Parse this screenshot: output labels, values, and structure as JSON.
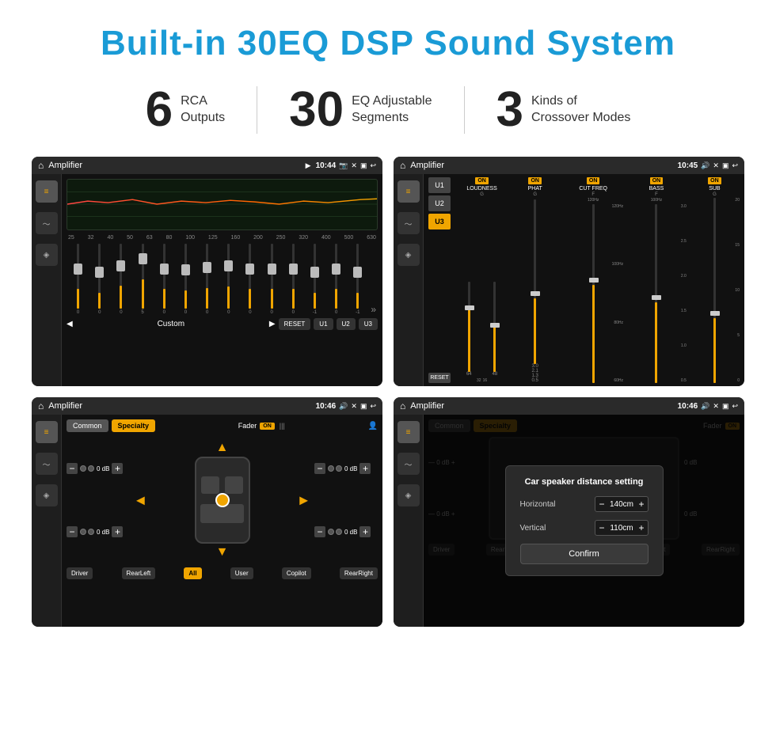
{
  "header": {
    "title": "Built-in 30EQ DSP Sound System"
  },
  "stats": [
    {
      "number": "6",
      "text_line1": "RCA",
      "text_line2": "Outputs"
    },
    {
      "number": "30",
      "text_line1": "EQ Adjustable",
      "text_line2": "Segments"
    },
    {
      "number": "3",
      "text_line1": "Kinds of",
      "text_line2": "Crossover Modes"
    }
  ],
  "screens": {
    "eq": {
      "title": "Amplifier",
      "time": "10:44",
      "freq_labels": [
        "25",
        "32",
        "40",
        "50",
        "63",
        "80",
        "100",
        "125",
        "160",
        "200",
        "250",
        "320",
        "400",
        "500",
        "630"
      ],
      "bottom_label": "Custom",
      "reset_btn": "RESET",
      "preset_btns": [
        "U1",
        "U2",
        "U3"
      ],
      "values": [
        "0",
        "0",
        "0",
        "5",
        "0",
        "0",
        "0",
        "0",
        "0",
        "0",
        "0",
        "-1",
        "0",
        "-1"
      ]
    },
    "dsp": {
      "title": "Amplifier",
      "time": "10:45",
      "presets": [
        "U1",
        "U2",
        "U3"
      ],
      "active_preset": "U3",
      "reset_btn": "RESET",
      "channels": [
        {
          "name": "LOUDNESS",
          "on": true
        },
        {
          "name": "PHAT",
          "on": true
        },
        {
          "name": "CUT FREQ",
          "on": true
        },
        {
          "name": "BASS",
          "on": true
        },
        {
          "name": "SUB",
          "on": true
        }
      ]
    },
    "fader": {
      "title": "Amplifier",
      "time": "10:46",
      "tabs": [
        "Common",
        "Specialty"
      ],
      "active_tab": "Specialty",
      "fader_label": "Fader",
      "on_badge": "ON",
      "controls_left": [
        {
          "label": "— 0 dB +",
          "value": "0 dB"
        },
        {
          "label": "— 0 dB +",
          "value": "0 dB"
        }
      ],
      "controls_right": [
        {
          "label": "— 0 dB +",
          "value": "0 dB"
        },
        {
          "label": "— 0 dB +",
          "value": "0 dB"
        }
      ],
      "bottom_btns": [
        "Driver",
        "RearLeft",
        "All",
        "User",
        "Copilot",
        "RearRight"
      ],
      "active_btn": "All"
    },
    "distance": {
      "title": "Amplifier",
      "time": "10:46",
      "dialog_title": "Car speaker distance setting",
      "horizontal_label": "Horizontal",
      "horizontal_value": "140cm",
      "vertical_label": "Vertical",
      "vertical_value": "110cm",
      "confirm_btn": "Confirm",
      "controls_right": [
        {
          "value": "0 dB"
        },
        {
          "value": "0 dB"
        }
      ],
      "bottom_btns_right": [
        "Copilot",
        "RearRight"
      ]
    }
  }
}
